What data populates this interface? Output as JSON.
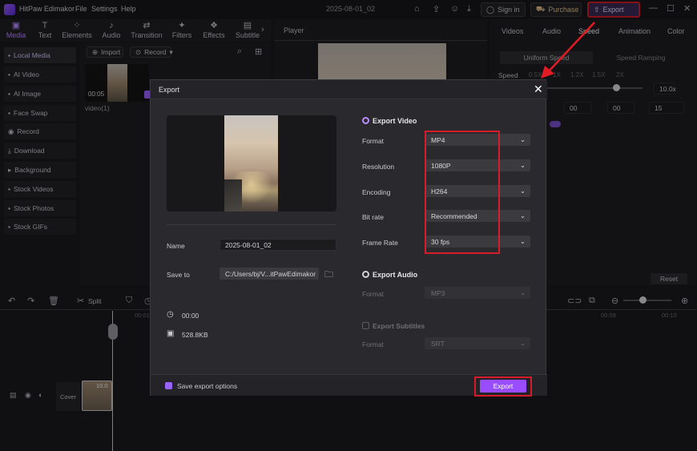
{
  "app": {
    "title": "HitPaw Edimakor",
    "menu": [
      "File",
      "Settings",
      "Help"
    ],
    "doc_title": "2025-08-01_02",
    "sign_in": "Sign in",
    "purchase": "Purchase",
    "export": "Export"
  },
  "toolbar": [
    "Media",
    "Text",
    "Elements",
    "Audio",
    "Transition",
    "Filters",
    "Effects",
    "Subtitle"
  ],
  "sidebar": [
    "Local Media",
    "AI Video",
    "AI Image",
    "Face Swap",
    "Record",
    "Download",
    "Background",
    "Stock Videos",
    "Stock Photos",
    "Stock GIFs"
  ],
  "media": {
    "import": "Import",
    "record": "Record",
    "clip_time": "00:05",
    "clip_name": "video(1)"
  },
  "player": {
    "title": "Player"
  },
  "right": {
    "tabs": [
      "Videos",
      "Audio",
      "Speed",
      "Animation",
      "Color"
    ],
    "speed_modes": [
      "Uniform Speed",
      "Speed Ramping"
    ],
    "speed_label": "Speed",
    "speed_marks": [
      "0.5X",
      "1X",
      "1.2X",
      "1.5X",
      "2X"
    ],
    "speed_value": "10.0x",
    "times": [
      "00",
      "00",
      "15"
    ],
    "reset": "Reset"
  },
  "timeline": {
    "split": "Split",
    "ticks": [
      "00:01",
      "00:09",
      "00:10"
    ],
    "cover": "Cover",
    "clip_duration": "10.0"
  },
  "modal": {
    "title": "Export",
    "name_label": "Name",
    "name_value": "2025-08-01_02",
    "save_label": "Save to",
    "save_value": "C:/Users/bj/V...itPawEdimakor",
    "duration": "00:00",
    "size": "528.8KB",
    "export_video": "Export Video",
    "rows": [
      {
        "label": "Format",
        "value": "MP4"
      },
      {
        "label": "Resolution",
        "value": "1080P"
      },
      {
        "label": "Encoding",
        "value": "H264"
      },
      {
        "label": "Bit rate",
        "value": "Recommended"
      },
      {
        "label": "Frame Rate",
        "value": "30  fps"
      }
    ],
    "export_audio": "Export Audio",
    "audio_format_label": "Format",
    "audio_format": "MP3",
    "export_subtitles": "Export Subtitles",
    "sub_format_label": "Format",
    "sub_format": "SRT",
    "save_options": "Save export options",
    "export_button": "Export"
  }
}
